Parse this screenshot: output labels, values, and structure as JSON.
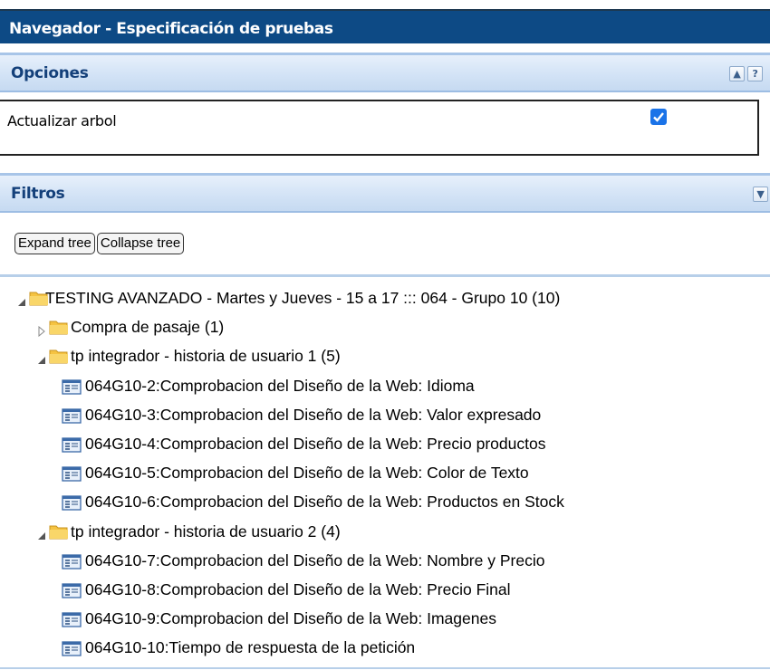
{
  "window": {
    "title": "Navegador - Especificación de pruebas"
  },
  "opciones": {
    "title": "Opciones",
    "collapse_glyph": "▲",
    "help_glyph": "?",
    "update_tree_label": "Actualizar arbol",
    "update_tree_checked": true
  },
  "filtros": {
    "title": "Filtros",
    "expand_glyph": "▼",
    "expand_tree_label": "Expand tree",
    "collapse_tree_label": "Collapse tree"
  },
  "tree": {
    "root": {
      "label": "TESTING AVANZADO - Martes y Jueves - 15 a 17 ::: 064 - Grupo 10 (10)",
      "expanded": true
    },
    "suites": [
      {
        "label": "Compra de pasaje (1)",
        "expanded": false,
        "cases": []
      },
      {
        "label": "tp integrador - historia de usuario 1 (5)",
        "expanded": true,
        "cases": [
          "064G10-2:Comprobacion del Diseño de la Web: Idioma",
          "064G10-3:Comprobacion del Diseño de la Web: Valor expresado",
          "064G10-4:Comprobacion del Diseño de la Web: Precio productos",
          "064G10-5:Comprobacion del Diseño de la Web: Color de Texto",
          "064G10-6:Comprobacion del Diseño de la Web: Productos en Stock"
        ]
      },
      {
        "label": "tp integrador - historia de usuario 2 (4)",
        "expanded": true,
        "cases": [
          "064G10-7:Comprobacion del Diseño de la Web: Nombre y Precio",
          "064G10-8:Comprobacion del Diseño de la Web: Precio Final",
          "064G10-9:Comprobacion del Diseño de la Web: Imagenes",
          "064G10-10:Tiempo de respuesta de la petición"
        ]
      }
    ]
  },
  "icons": {
    "folder": "folder-icon",
    "test_case": "test-case-icon",
    "expanded_toggle": "expanded-triangle-icon",
    "collapsed_toggle": "collapsed-triangle-icon",
    "checkbox": "checkmark-icon"
  },
  "colors": {
    "title_bar": "#0d4a85",
    "panel_header_text": "#14407a",
    "checkbox": "#1a73e8",
    "folder": "#f5c342"
  }
}
